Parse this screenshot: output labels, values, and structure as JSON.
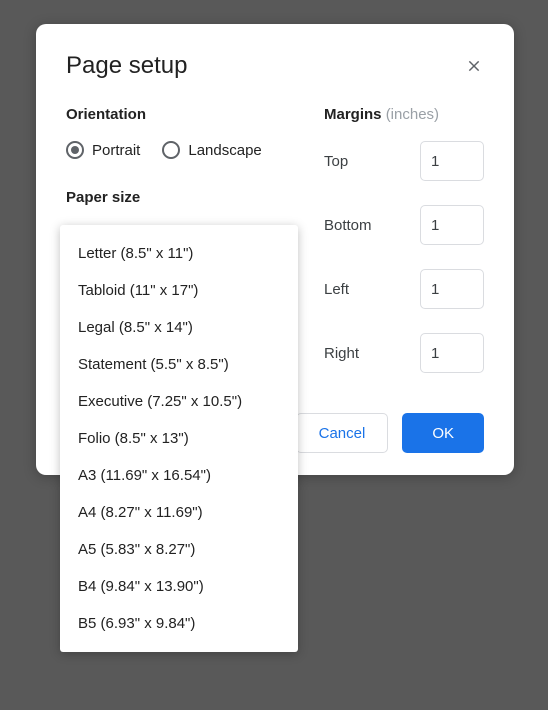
{
  "dialog": {
    "title": "Page setup"
  },
  "orientation": {
    "label": "Orientation",
    "portrait": "Portrait",
    "landscape": "Landscape",
    "selected": "portrait"
  },
  "paper_size": {
    "label": "Paper size",
    "options": [
      "Letter (8.5\" x 11\")",
      "Tabloid (11\" x 17\")",
      "Legal (8.5\" x 14\")",
      "Statement (5.5\" x 8.5\")",
      "Executive (7.25\" x 10.5\")",
      "Folio (8.5\" x 13\")",
      "A3 (11.69\" x 16.54\")",
      "A4 (8.27\" x 11.69\")",
      "A5 (5.83\" x 8.27\")",
      "B4 (9.84\" x 13.90\")",
      "B5 (6.93\" x 9.84\")"
    ]
  },
  "margins": {
    "label": "Margins",
    "unit": "(inches)",
    "top": {
      "label": "Top",
      "value": "1"
    },
    "bottom": {
      "label": "Bottom",
      "value": "1"
    },
    "left": {
      "label": "Left",
      "value": "1"
    },
    "right": {
      "label": "Right",
      "value": "1"
    }
  },
  "buttons": {
    "cancel": "Cancel",
    "ok": "OK"
  }
}
